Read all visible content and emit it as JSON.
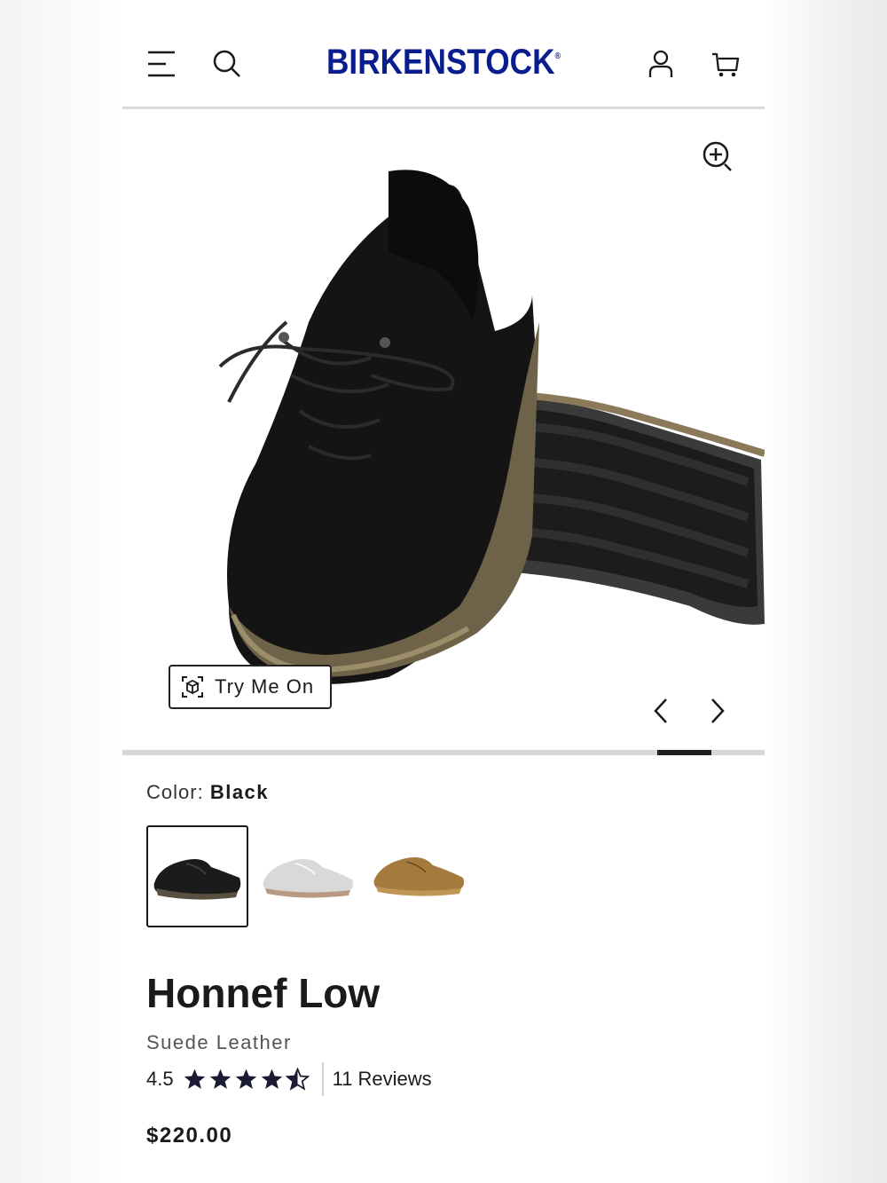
{
  "header": {
    "logo_text": "BIRKENSTOCK",
    "logo_mark": "®",
    "brand_color": "#0a1d8f",
    "icons": [
      "menu-icon",
      "search-icon",
      "account-icon",
      "cart-icon"
    ]
  },
  "gallery": {
    "zoom_icon": "zoom-in-icon",
    "try_on_label": "Try Me On",
    "try_on_icon": "ar-cube-icon",
    "prev_icon": "chevron-left-icon",
    "next_icon": "chevron-right-icon"
  },
  "product": {
    "color_label": "Color:",
    "color_value": "Black",
    "swatches": [
      {
        "name": "Black",
        "selected": true,
        "color": "#1a1a1a"
      },
      {
        "name": "Light Gray",
        "selected": false,
        "color": "#d7d7d7"
      },
      {
        "name": "Tan",
        "selected": false,
        "color": "#a47a3e"
      }
    ],
    "title": "Honnef Low",
    "material": "Suede Leather",
    "rating_value": "4.5",
    "rating": 4.5,
    "reviews_label": "11 Reviews",
    "price": "$220.00"
  }
}
